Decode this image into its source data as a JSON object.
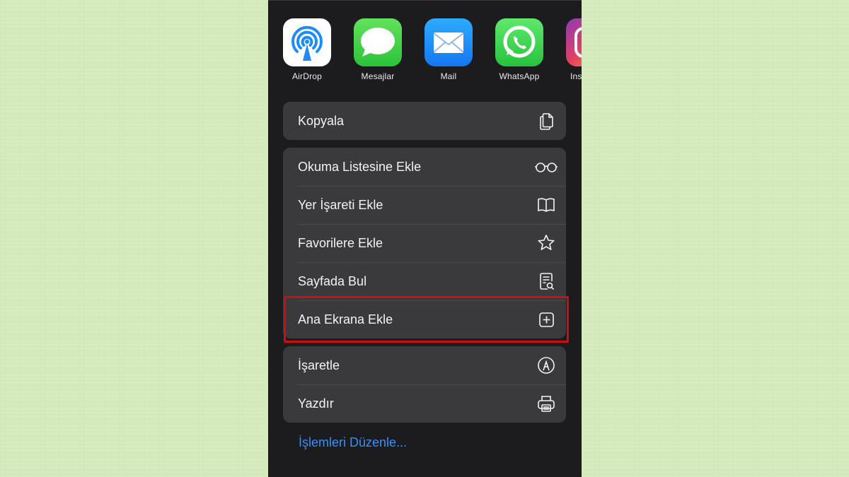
{
  "share_sheet": {
    "apps": [
      {
        "label": "AirDrop",
        "icon": "airdrop-icon"
      },
      {
        "label": "Mesajlar",
        "icon": "messages-icon"
      },
      {
        "label": "Mail",
        "icon": "mail-icon"
      },
      {
        "label": "WhatsApp",
        "icon": "whatsapp-icon"
      },
      {
        "label": "Ins",
        "icon": "instagram-icon"
      }
    ],
    "group1": [
      {
        "label": "Kopyala",
        "icon": "copy-icon"
      }
    ],
    "group2": [
      {
        "label": "Okuma Listesine Ekle",
        "icon": "glasses-icon"
      },
      {
        "label": "Yer İşareti Ekle",
        "icon": "book-icon"
      },
      {
        "label": "Favorilere Ekle",
        "icon": "star-icon"
      },
      {
        "label": "Sayfada Bul",
        "icon": "find-on-page-icon"
      },
      {
        "label": "Ana Ekrana Ekle",
        "icon": "add-square-icon",
        "highlighted": true
      }
    ],
    "group3": [
      {
        "label": "İşaretle",
        "icon": "markup-icon"
      },
      {
        "label": "Yazdır",
        "icon": "printer-icon"
      }
    ],
    "edit_actions": "İşlemleri Düzenle..."
  },
  "colors": {
    "background": "#d4eabc",
    "sheet": "#1c1c1e",
    "row": "#3a3a3c",
    "link": "#3b8ff5",
    "highlight": "#cc0d12"
  }
}
